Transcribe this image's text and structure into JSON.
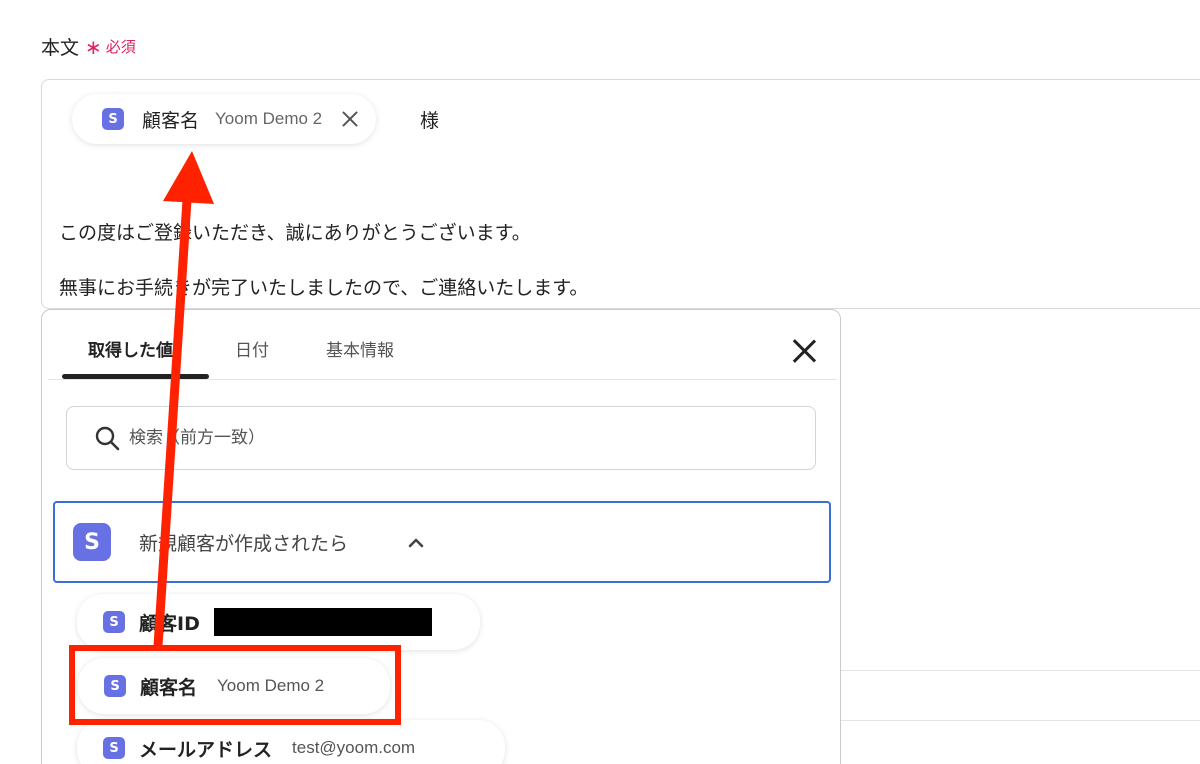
{
  "field": {
    "label": "本文",
    "required_mark": "∗",
    "required_text": "必須"
  },
  "editor": {
    "chip": {
      "badge": "S",
      "name": "顧客名",
      "value": "Yoom Demo 2"
    },
    "suffix": "様",
    "line1": "この度はご登録いただき、誠にありがとうございます。",
    "line2": "無事にお手続きが完了いたしましたので、ご連絡いたします。"
  },
  "popover": {
    "tabs": [
      {
        "label": "取得した値"
      },
      {
        "label": "日付"
      },
      {
        "label": "基本情報"
      }
    ],
    "search": {
      "placeholder": "検索（前方一致）"
    },
    "group": {
      "badge": "S",
      "title": "新規顧客が作成されたら"
    },
    "items": [
      {
        "badge": "S",
        "name": "顧客ID",
        "value": ""
      },
      {
        "badge": "S",
        "name": "顧客名",
        "value": "Yoom Demo 2"
      },
      {
        "badge": "S",
        "name": "メールアドレス",
        "value": "test@yoom.com"
      }
    ]
  },
  "colors": {
    "accent": "#6771e3",
    "annotation": "#ff2200",
    "required": "#e0245e",
    "focus": "#3a6fd8"
  }
}
